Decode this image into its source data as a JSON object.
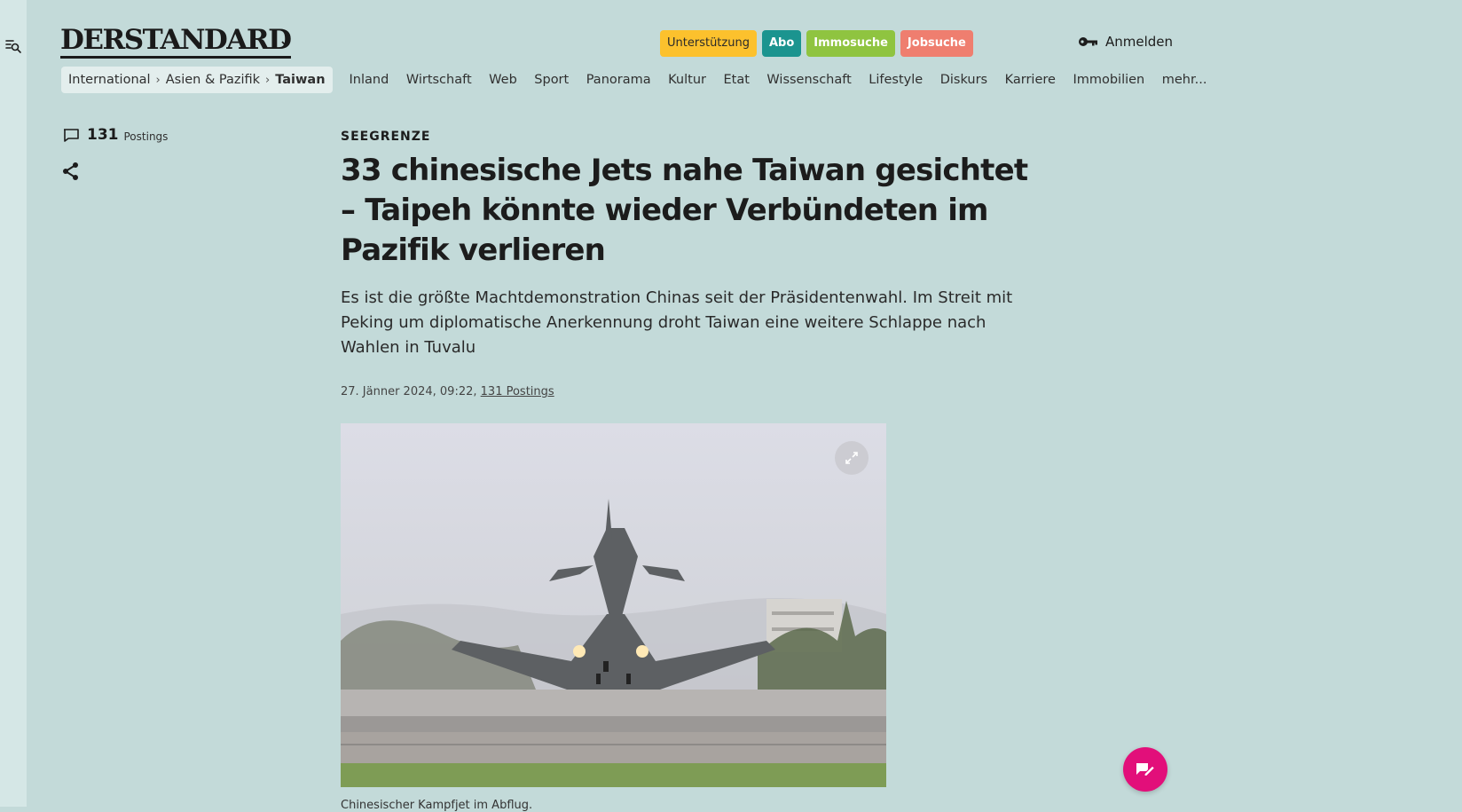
{
  "header": {
    "logo": "DERSTANDARD",
    "promos": [
      "Unterstützung",
      "Abo",
      "Immosuche",
      "Jobsuche"
    ],
    "login": "Anmelden"
  },
  "breadcrumb": {
    "items": [
      "International",
      "Asien & Pazifik",
      "Taiwan"
    ],
    "separator": "›"
  },
  "sections": [
    "Inland",
    "Wirtschaft",
    "Web",
    "Sport",
    "Panorama",
    "Kultur",
    "Etat",
    "Wissenschaft",
    "Lifestyle",
    "Diskurs",
    "Karriere",
    "Immobilien",
    "mehr..."
  ],
  "sidebar": {
    "postings_count": "131",
    "postings_label": "Postings"
  },
  "article": {
    "kicker": "SEEGRENZE",
    "headline": "33 chinesische Jets nahe Taiwan gesichtet – Taipeh könnte wieder Verbündeten im Pazifik verlieren",
    "lead": "Es ist die größte Machtdemonstration Chinas seit der Präsidentenwahl. Im Streit mit Peking um diplomatische Anerkennung droht Taiwan eine weitere Schlappe nach Wahlen in Tuvalu",
    "date": "27. Jänner 2024, 09:22,",
    "postings_link": "131 Postings",
    "image_caption": "Chinesischer Kampfjet im Abflug."
  },
  "colors": {
    "background": "#c3dad9",
    "promo_support": "#fcc12d",
    "promo_abo": "#1b948f",
    "promo_immo": "#8fc440",
    "promo_job": "#ef7e6f",
    "fab": "#e20f7a"
  }
}
